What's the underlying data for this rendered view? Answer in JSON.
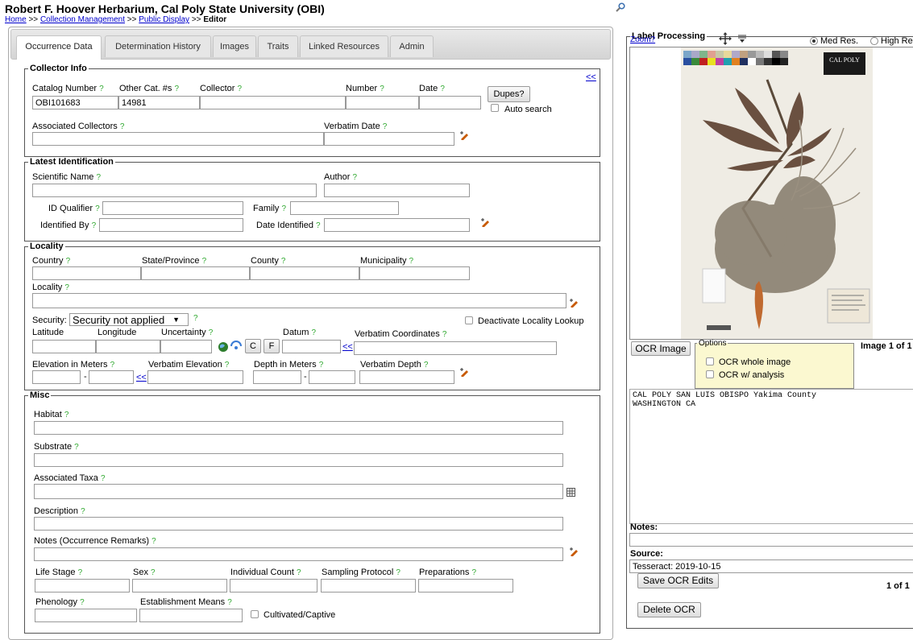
{
  "header": {
    "title": "Robert F. Hoover Herbarium, Cal Poly State University (OBI)",
    "crumb_home": "Home",
    "crumb_sep1": ">>",
    "crumb_collection": "Collection Management",
    "crumb_sep2": ">>",
    "crumb_public": "Public Display",
    "crumb_sep3": ">>",
    "crumb_current": "Editor"
  },
  "tabs": [
    "Occurrence Data",
    "Determination History",
    "Images",
    "Traits",
    "Linked Resources",
    "Admin"
  ],
  "q": "?",
  "collector": {
    "legend": "Collector Info",
    "collapse": "<<",
    "catalog_label": "Catalog Number",
    "catalog_value": "OBI101683",
    "othercat_label": "Other Cat. #s",
    "othercat_value": "14981",
    "collector_label": "Collector",
    "number_label": "Number",
    "date_label": "Date",
    "dupes": "Dupes?",
    "auto_search": "Auto search",
    "assoc_label": "Associated Collectors",
    "verbatim_date_label": "Verbatim Date"
  },
  "ident": {
    "legend": "Latest Identification",
    "sciname_label": "Scientific Name",
    "author_label": "Author",
    "qualifier_label": "ID Qualifier",
    "family_label": "Family",
    "identby_label": "Identified By",
    "dateid_label": "Date Identified"
  },
  "locality": {
    "legend": "Locality",
    "country_label": "Country",
    "state_label": "State/Province",
    "county_label": "County",
    "municipality_label": "Municipality",
    "locality_label": "Locality",
    "security_label": "Security:",
    "security_value": "Security not applied",
    "deactivate_label": "Deactivate Locality Lookup",
    "lat_label": "Latitude",
    "lon_label": "Longitude",
    "uncert_label": "Uncertainty",
    "c_btn": "C",
    "f_btn": "F",
    "datum_label": "Datum",
    "lt": "<<",
    "verbcoord_label": "Verbatim Coordinates",
    "elev_label": "Elevation in Meters",
    "verbelev_label": "Verbatim Elevation",
    "depth_label": "Depth in Meters",
    "verbdepth_label": "Verbatim Depth",
    "dash": "-"
  },
  "misc": {
    "legend": "Misc",
    "habitat_label": "Habitat",
    "substrate_label": "Substrate",
    "assoctaxa_label": "Associated Taxa",
    "description_label": "Description",
    "notes_label": "Notes (Occurrence Remarks)",
    "lifestage_label": "Life Stage",
    "sex_label": "Sex",
    "indcount_label": "Individual Count",
    "sampling_label": "Sampling Protocol",
    "prep_label": "Preparations",
    "phenology_label": "Phenology",
    "estab_label": "Establishment Means",
    "cultivated_label": "Cultivated/Captive"
  },
  "label_panel": {
    "legend": "Label Processing",
    "zoom": "Zoom?",
    "med_res": "Med Res.",
    "high_res": "High Re",
    "ocr_image_btn": "OCR Image",
    "options_legend": "Options",
    "ocr_whole": "OCR whole image",
    "ocr_analysis": "OCR w/ analysis",
    "image_counter": "Image 1 of 1",
    "ocr_text": "CAL POLY SAN LUIS OBISPO Yakima County\nWASHINGTON CA",
    "notes_label": "Notes:",
    "source_label": "Source:",
    "source_value": "Tesseract: 2019-10-15",
    "save_btn": "Save OCR Edits",
    "ocr_counter": "1 of 1",
    "delete_btn": "Delete OCR",
    "specimen_label": "CAL POLY"
  }
}
